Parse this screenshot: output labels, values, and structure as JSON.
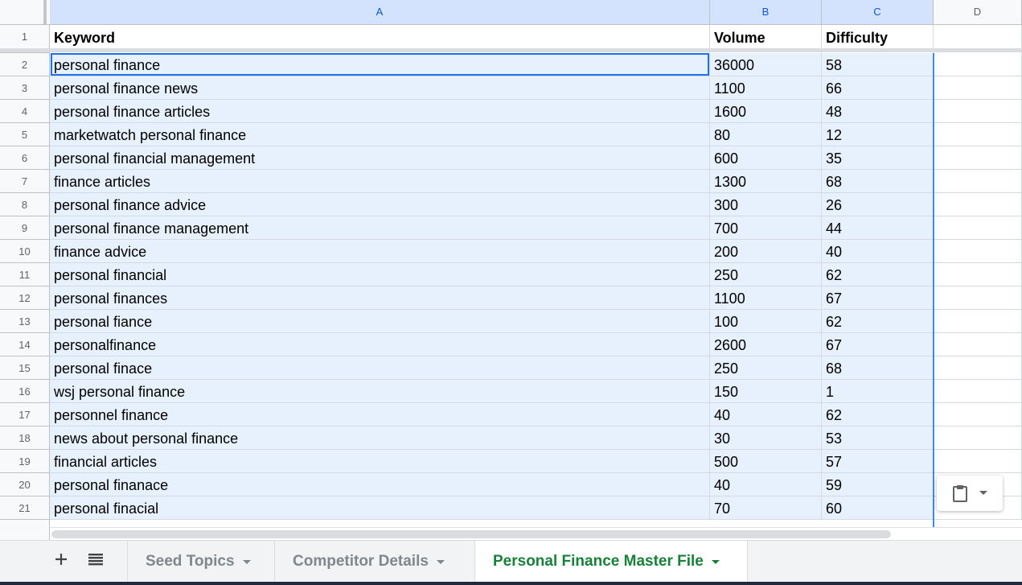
{
  "columns": [
    "A",
    "B",
    "C",
    "D"
  ],
  "header": {
    "row_num": "1",
    "keyword": "Keyword",
    "volume": "Volume",
    "difficulty": "Difficulty"
  },
  "rows": [
    {
      "n": "2",
      "keyword": "personal finance",
      "volume": "36000",
      "difficulty": "58"
    },
    {
      "n": "3",
      "keyword": "personal finance news",
      "volume": "1100",
      "difficulty": "66"
    },
    {
      "n": "4",
      "keyword": "personal finance articles",
      "volume": "1600",
      "difficulty": "48"
    },
    {
      "n": "5",
      "keyword": "marketwatch personal finance",
      "volume": "80",
      "difficulty": "12"
    },
    {
      "n": "6",
      "keyword": "personal financial management",
      "volume": "600",
      "difficulty": "35"
    },
    {
      "n": "7",
      "keyword": "finance articles",
      "volume": "1300",
      "difficulty": "68"
    },
    {
      "n": "8",
      "keyword": "personal finance advice",
      "volume": "300",
      "difficulty": "26"
    },
    {
      "n": "9",
      "keyword": "personal finance management",
      "volume": "700",
      "difficulty": "44"
    },
    {
      "n": "10",
      "keyword": "finance advice",
      "volume": "200",
      "difficulty": "40"
    },
    {
      "n": "11",
      "keyword": "personal financial",
      "volume": "250",
      "difficulty": "62"
    },
    {
      "n": "12",
      "keyword": "personal finances",
      "volume": "1100",
      "difficulty": "67"
    },
    {
      "n": "13",
      "keyword": "personal fiance",
      "volume": "100",
      "difficulty": "62"
    },
    {
      "n": "14",
      "keyword": "personalfinance",
      "volume": "2600",
      "difficulty": "67"
    },
    {
      "n": "15",
      "keyword": "personal finace",
      "volume": "250",
      "difficulty": "68"
    },
    {
      "n": "16",
      "keyword": "wsj personal finance",
      "volume": "150",
      "difficulty": "1"
    },
    {
      "n": "17",
      "keyword": "personnel finance",
      "volume": "40",
      "difficulty": "62"
    },
    {
      "n": "18",
      "keyword": "news about personal finance",
      "volume": "30",
      "difficulty": "53"
    },
    {
      "n": "19",
      "keyword": "financial articles",
      "volume": "500",
      "difficulty": "57"
    },
    {
      "n": "20",
      "keyword": "personal finanace",
      "volume": "40",
      "difficulty": "59"
    },
    {
      "n": "21",
      "keyword": "personal finacial",
      "volume": "70",
      "difficulty": "60"
    }
  ],
  "tabs": [
    {
      "label": "Seed Topics",
      "active": false
    },
    {
      "label": "Competitor Details",
      "active": false
    },
    {
      "label": "Personal Finance Master File",
      "active": true
    }
  ],
  "icons": {
    "add_sheet": "plus-icon",
    "all_sheets": "list-icon",
    "paste": "clipboard-icon",
    "paste_menu": "caret-down-icon"
  },
  "colors": {
    "selection": "#e7f0fd",
    "active_border": "#1a73e8",
    "active_tab": "#188038"
  }
}
